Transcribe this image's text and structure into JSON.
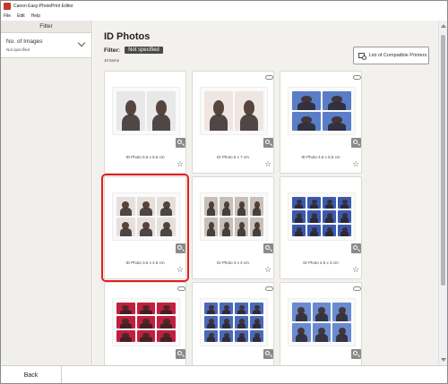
{
  "window": {
    "title": "Canon Easy-PhotoPrint Editor"
  },
  "menu": [
    "File",
    "Edit",
    "Help"
  ],
  "sidebar": {
    "heading": "Filter",
    "filter_label": "No. of Images",
    "filter_value": "Not specified"
  },
  "main": {
    "title": "ID Photos",
    "filter_key": "Filter:",
    "filter_chip": "Not specified",
    "count": "10 items",
    "compat_button": "List of Compatible Printers"
  },
  "cards": [
    {
      "caption": "ID Photo 5.6 x 5.6 cm",
      "cols": 2,
      "rows": 1,
      "bg": "#e8e8e8",
      "selected": false,
      "cloud": false
    },
    {
      "caption": "ID Photo 5 x 7 cm",
      "cols": 2,
      "rows": 1,
      "bg": "#f0e6e1",
      "selected": false,
      "cloud": true
    },
    {
      "caption": "ID Photo 4.5 x 5.5 cm",
      "cols": 2,
      "rows": 2,
      "bg": "#5a7dc8",
      "selected": false,
      "cloud": true
    },
    {
      "caption": "ID Photo 3.5 x 4.5 cm",
      "cols": 3,
      "rows": 2,
      "bg": "#e6e0dc",
      "selected": true,
      "cloud": false
    },
    {
      "caption": "ID Photo 3 x 4 cm",
      "cols": 4,
      "rows": 2,
      "bg": "#c8c0b8",
      "selected": false,
      "cloud": false
    },
    {
      "caption": "ID Photo 2.5 x 3 cm",
      "cols": 4,
      "rows": 3,
      "bg": "#3a5ab0",
      "selected": false,
      "cloud": false
    },
    {
      "caption": "",
      "cols": 3,
      "rows": 3,
      "bg": "#c02040",
      "selected": false,
      "cloud": true
    },
    {
      "caption": "",
      "cols": 4,
      "rows": 3,
      "bg": "#4a6ab8",
      "selected": false,
      "cloud": true
    },
    {
      "caption": "",
      "cols": 3,
      "rows": 2,
      "bg": "#6a8ad0",
      "selected": false,
      "cloud": true
    }
  ],
  "footer": {
    "back": "Back"
  },
  "icons": {
    "zoom": "magnifier-icon",
    "favorite": "star-icon",
    "cloud": "cloud-icon",
    "printers": "printer-list-icon",
    "filter_toggle": "chevron-down-icon"
  }
}
